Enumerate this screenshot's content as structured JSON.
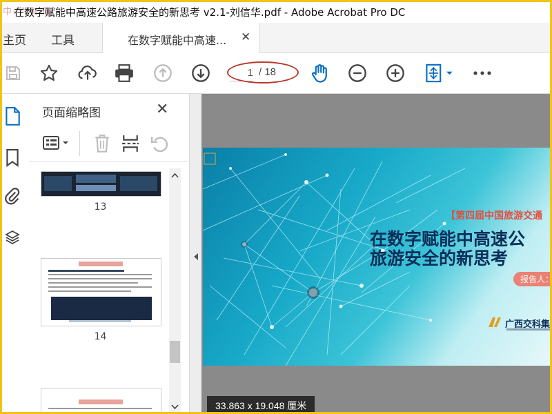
{
  "window": {
    "title": "在数字赋能中高速公路旅游安全的新思考 v2.1-刘信华.pdf - Adobe Acrobat Pro DC",
    "watermark": "中·字·有·码"
  },
  "nav": {
    "home": "主页",
    "tools": "工具",
    "doc_tab_label": "在数字赋能中高速...",
    "doc_tab_close": "✕"
  },
  "toolbar": {
    "page_current": "1",
    "page_total": "/ 18",
    "icons": [
      "save-icon",
      "bookmark-star-icon",
      "upload-cloud-icon",
      "print-icon",
      "page-up-icon",
      "page-down-icon",
      "hand-tool-icon",
      "zoom-out-icon",
      "zoom-in-icon",
      "fit-page-icon",
      "more-icon"
    ]
  },
  "panel": {
    "title": "页面缩略图",
    "close": "✕",
    "pages": [
      "13",
      "14"
    ]
  },
  "document": {
    "subtitle": "【第四届中国旅游交通",
    "title_line1": "在数字赋能中高速公",
    "title_line2": "旅游安全的新思考",
    "reporter": "报告人：",
    "company": "广西交科集团"
  },
  "status": {
    "dimensions": "33.863 x 19.048 厘米"
  },
  "colors": {
    "accent": "#0d6fc4",
    "annotation": "#b83a2d",
    "subtitle": "#e74c3c",
    "title_text": "#0b2f5a"
  }
}
